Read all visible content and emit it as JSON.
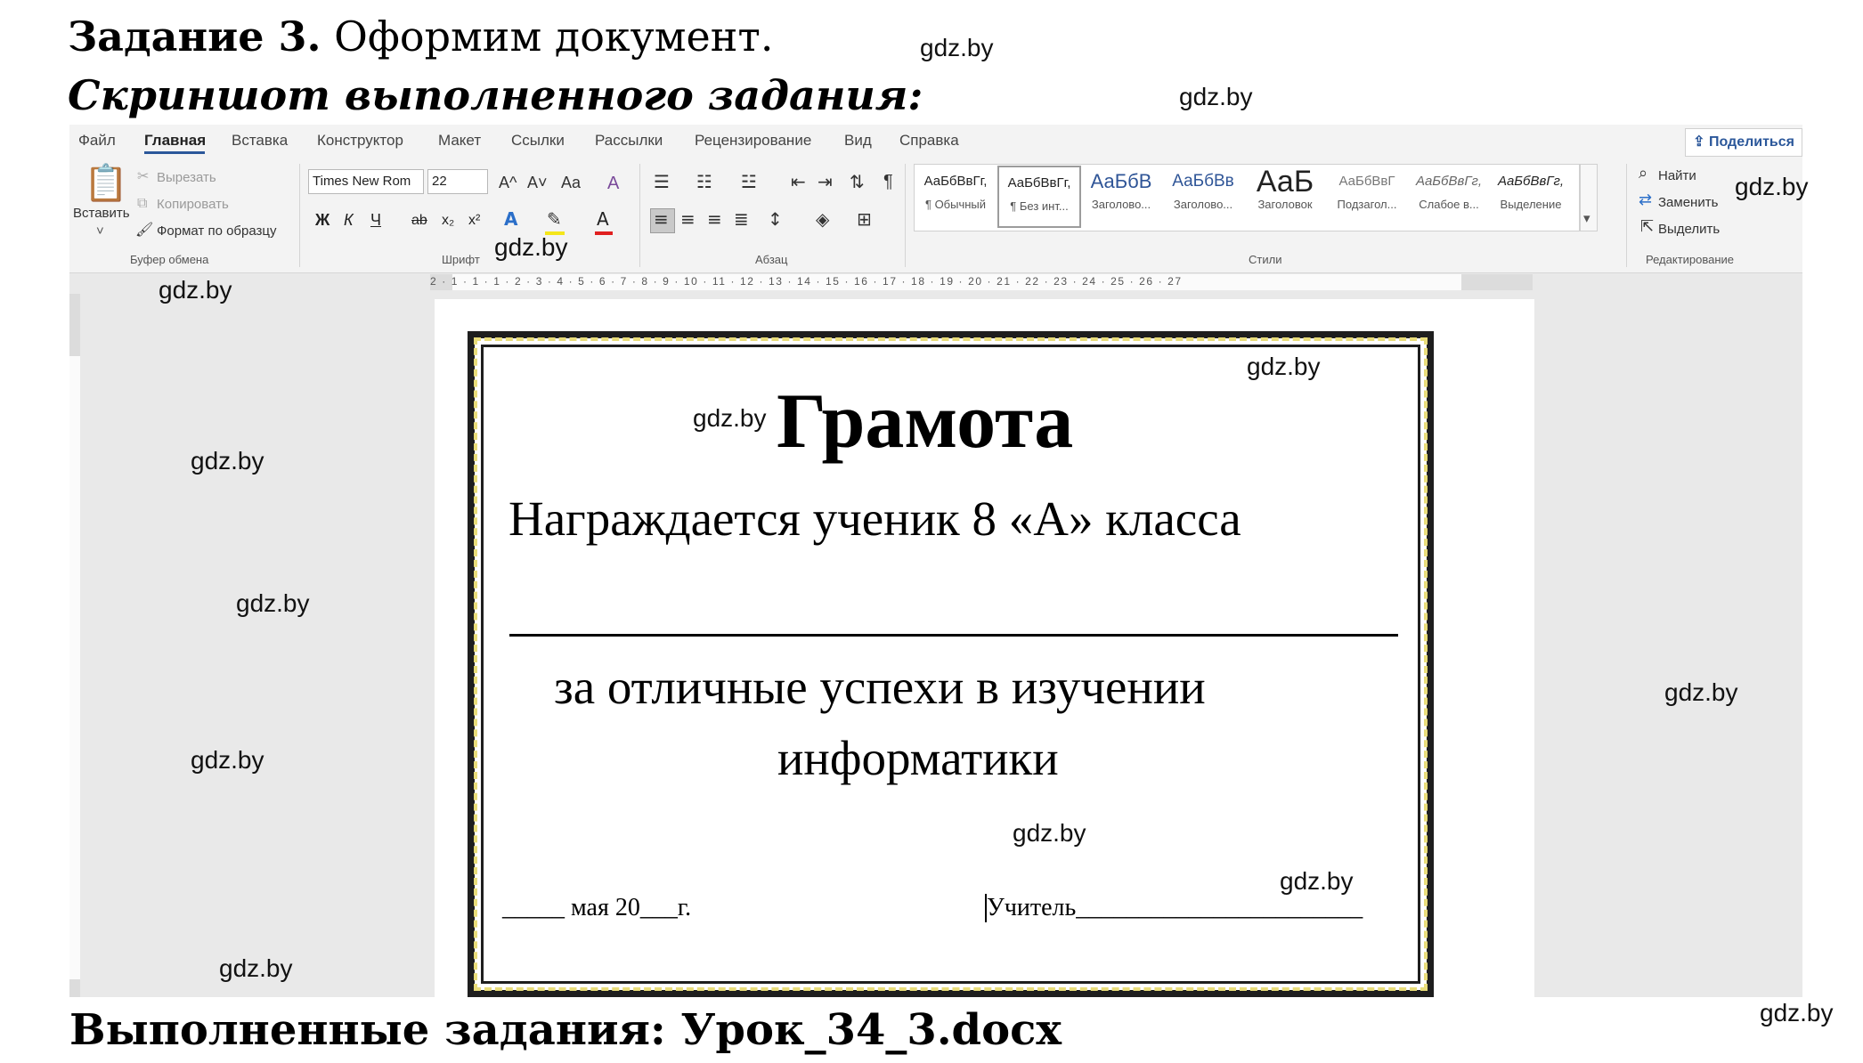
{
  "header": {
    "task_bold": "Задание 3.",
    "task_rest": "Оформим документ.",
    "subtitle": "Скриншот выполненного задания:"
  },
  "footer": {
    "done": "Выполненные задания: Урок_34_3.docx"
  },
  "watermark": "gdz.by",
  "ribbon": {
    "tabs": [
      "Файл",
      "Главная",
      "Вставка",
      "Конструктор",
      "Макет",
      "Ссылки",
      "Рассылки",
      "Рецензирование",
      "Вид",
      "Справка"
    ],
    "active_tab": "Главная",
    "share_label": "Поделиться",
    "clipboard": {
      "paste": "Вставить",
      "cut": "Вырезать",
      "copy": "Копировать",
      "format_painter": "Формат по образцу",
      "group": "Буфер обмена"
    },
    "font": {
      "name": "Times New Rom",
      "size": "22",
      "group": "Шрифт",
      "bold": "Ж",
      "italic": "К",
      "underline": "Ч",
      "strike": "ab",
      "sub": "x₂",
      "sup": "x²",
      "grow": "A^",
      "shrink": "A˅",
      "case": "Aa",
      "clear": "A"
    },
    "paragraph": {
      "group": "Абзац",
      "pilcrow": "¶"
    },
    "styles": {
      "group": "Стили",
      "items": [
        {
          "preview": "АаБбВвГг,",
          "name": "¶ Обычный"
        },
        {
          "preview": "АаБбВвГг,",
          "name": "¶ Без инт..."
        },
        {
          "preview": "АаБбВ",
          "name": "Заголово..."
        },
        {
          "preview": "АаБбВв",
          "name": "Заголово..."
        },
        {
          "preview": "АаБ",
          "name": "Заголовок"
        },
        {
          "preview": "АаБбВвГ",
          "name": "Подзагол..."
        },
        {
          "preview": "АаБбВвГг,",
          "name": "Слабое в..."
        },
        {
          "preview": "АаБбВвГг,",
          "name": "Выделение"
        }
      ]
    },
    "editing": {
      "find": "Найти",
      "replace": "Заменить",
      "select": "Выделить",
      "group": "Редактирование"
    },
    "accent": "#2b579a"
  },
  "ruler": {
    "h_ticks": "2 · 1 · 1 · 1 · 2 · 3 · 4 · 5 · 6 · 7 · 8 · 9 · 10 · 11 · 12 · 13 · 14 · 15 · 16 · 17 · 18 · 19 · 20 · 21 · 22 · 23 · 24 · 25 · 26 · 27"
  },
  "document": {
    "title": "Грамота",
    "line1": "Награждается ученик 8 «А» класса",
    "line2": "за отличные успехи в изучении",
    "line3": "информатики",
    "date": "_____ мая 20___г.",
    "teacher": "Учитель_______________________"
  }
}
